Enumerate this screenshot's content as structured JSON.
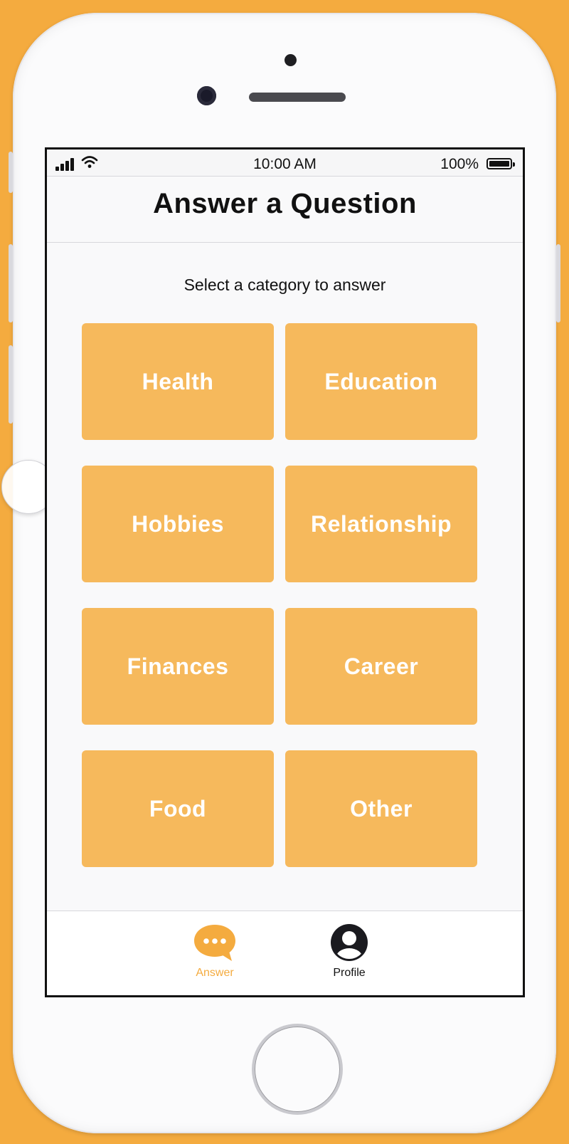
{
  "status_bar": {
    "time": "10:00 AM",
    "battery_percent": "100%"
  },
  "header": {
    "title": "Answer a Question"
  },
  "main": {
    "subtitle": "Select a category to answer",
    "categories": [
      {
        "label": "Health"
      },
      {
        "label": "Education"
      },
      {
        "label": "Hobbies"
      },
      {
        "label": "Relationship"
      },
      {
        "label": "Finances"
      },
      {
        "label": "Career"
      },
      {
        "label": "Food"
      },
      {
        "label": "Other"
      }
    ]
  },
  "tab_bar": {
    "tabs": [
      {
        "label": "Answer",
        "icon": "chat-bubble-icon",
        "active": true
      },
      {
        "label": "Profile",
        "icon": "user-avatar-icon",
        "active": false
      }
    ]
  },
  "colors": {
    "accent": "#F4AB3F",
    "category_tile": "#F6B95C",
    "background": "#F4AB3F"
  }
}
